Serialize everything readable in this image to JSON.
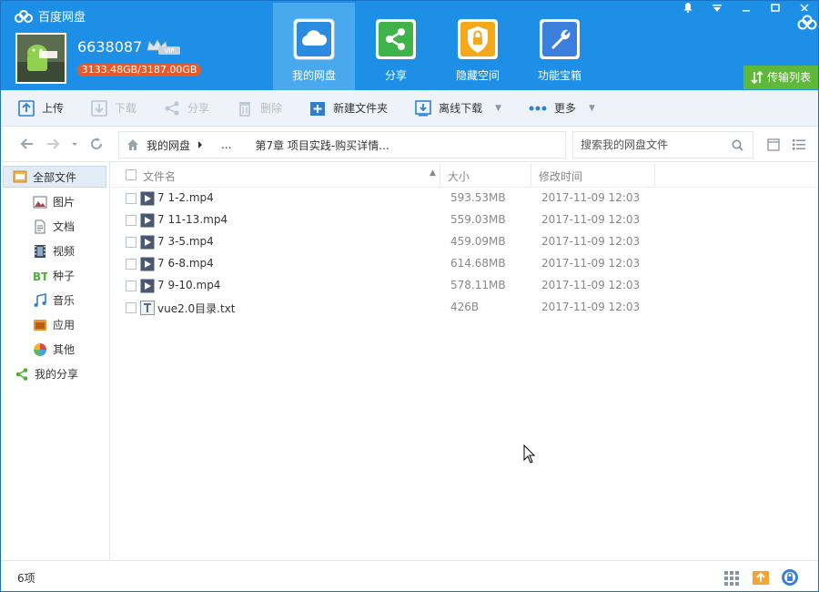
{
  "app": {
    "title": "百度网盘"
  },
  "user": {
    "name": "6638087",
    "vip": "VIP",
    "quota": "3133.48GB/3187.00GB"
  },
  "nav": [
    {
      "label": "我的网盘",
      "icon": "cloud-icon",
      "active": true
    },
    {
      "label": "分享",
      "icon": "share-icon",
      "active": false
    },
    {
      "label": "隐藏空间",
      "icon": "lock-icon",
      "active": false
    },
    {
      "label": "功能宝箱",
      "icon": "wrench-icon",
      "active": false
    }
  ],
  "transfer_label": "传输列表",
  "toolbar": {
    "upload": "上传",
    "download": "下载",
    "share": "分享",
    "delete": "删除",
    "new_folder": "新建文件夹",
    "offline": "离线下载",
    "more": "更多"
  },
  "addr": {
    "root": "我的网盘",
    "ellipsis": "...",
    "current": "第7章 项目实践-购买详情...",
    "search_placeholder": "搜索我的网盘文件"
  },
  "sidebar": {
    "all": "全部文件",
    "items": [
      "图片",
      "文档",
      "视频",
      "种子",
      "音乐",
      "应用",
      "其他"
    ],
    "share": "我的分享"
  },
  "columns": {
    "name": "文件名",
    "size": "大小",
    "time": "修改时间"
  },
  "files": [
    {
      "name": "7 1-2.mp4",
      "size": "593.53MB",
      "time": "2017-11-09 12:03",
      "type": "video"
    },
    {
      "name": "7 11-13.mp4",
      "size": "559.03MB",
      "time": "2017-11-09 12:03",
      "type": "video"
    },
    {
      "name": "7 3-5.mp4",
      "size": "459.09MB",
      "time": "2017-11-09 12:03",
      "type": "video"
    },
    {
      "name": "7 6-8.mp4",
      "size": "614.68MB",
      "time": "2017-11-09 12:03",
      "type": "video"
    },
    {
      "name": "7 9-10.mp4",
      "size": "578.11MB",
      "time": "2017-11-09 12:03",
      "type": "video"
    },
    {
      "name": "vue2.0目录.txt",
      "size": "426B",
      "time": "2017-11-09 12:03",
      "type": "text"
    }
  ],
  "status": {
    "count": "6项"
  }
}
